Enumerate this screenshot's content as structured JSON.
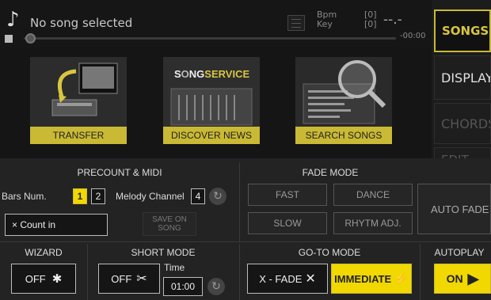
{
  "player": {
    "song_title": "No song selected",
    "bpm_label": "Bpm",
    "key_label": "Key",
    "bpm_value": "[0]",
    "key_value": "[0]",
    "tempo_display": "--.-",
    "remaining_time": "-00:00",
    "progress": 0
  },
  "sidebar": {
    "songs": "SONGS",
    "display": "DISPLAY",
    "chords": "CHORDS",
    "edit": "EDIT"
  },
  "tiles": {
    "transfer": "TRANSFER",
    "discover": "DISCOVER NEWS",
    "search": "SEARCH SONGS",
    "songservice_logo": "SONGSERVICE"
  },
  "precount": {
    "header": "PRECOUNT & MIDI",
    "bars_label": "Bars Num.",
    "bars_opt1": "1",
    "bars_opt2": "2",
    "melody_label": "Melody Channel",
    "melody_value": "4",
    "count_in": "× Count in",
    "save_on_song": "SAVE ON SONG"
  },
  "fade": {
    "header": "FADE MODE",
    "fast": "FAST",
    "dance": "DANCE",
    "slow": "SLOW",
    "rhythm_adj": "RHYTM ADJ.",
    "auto_fade": "AUTO FADE"
  },
  "wizard": {
    "header": "WIZARD",
    "state": "OFF"
  },
  "short_mode": {
    "header": "SHORT MODE",
    "state": "OFF",
    "time_label": "Time",
    "time_value": "01:00"
  },
  "goto": {
    "header": "GO-TO MODE",
    "xfade": "X - FADE",
    "immediate": "IMMEDIATE"
  },
  "autoplay": {
    "header": "AUTOPLAY",
    "state": "ON"
  },
  "colors": {
    "accent": "#f0d800",
    "panel": "#232323"
  }
}
